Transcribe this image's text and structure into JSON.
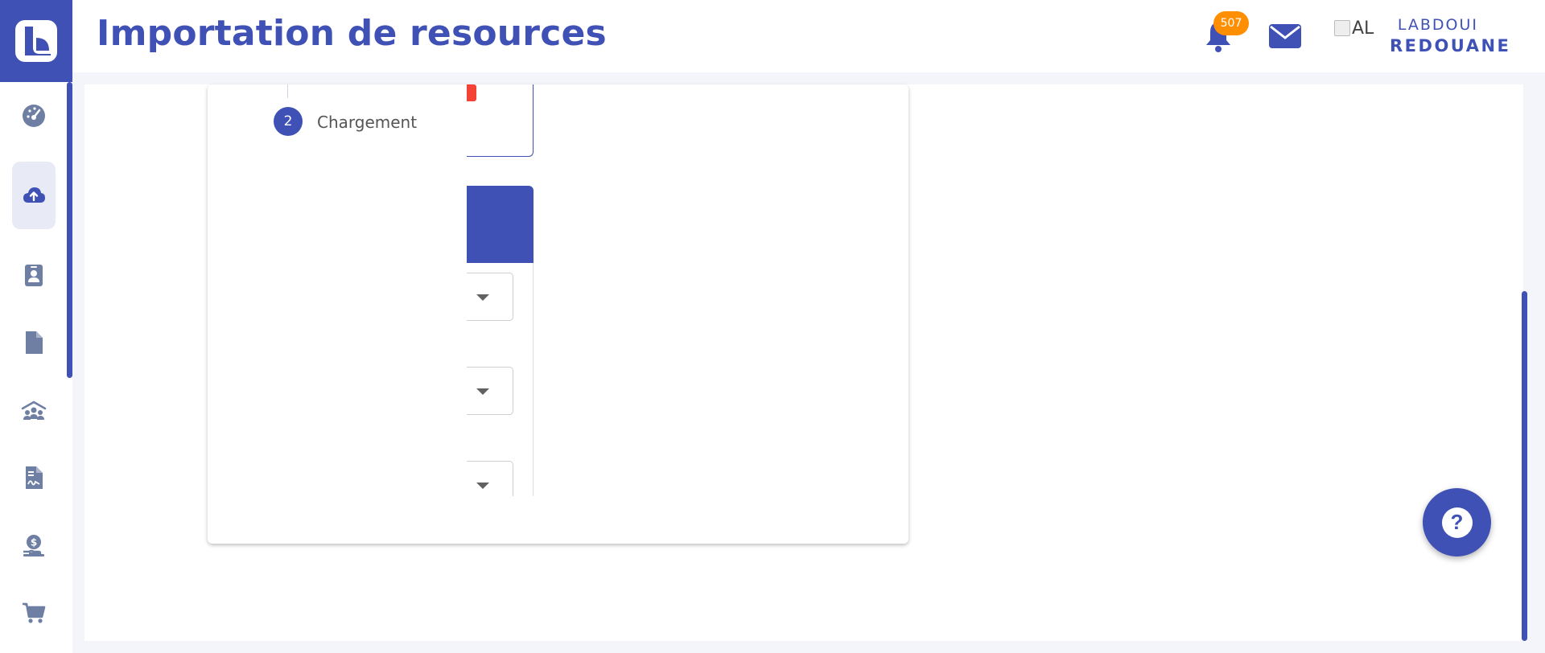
{
  "header": {
    "title": "Importation de resources",
    "notifications_count": "507",
    "avatar_alt": "AL",
    "user_first": "LABDOUI",
    "user_last": "REDOUANE"
  },
  "sidebar": {
    "items": [
      {
        "icon": "dashboard-gauge-icon"
      },
      {
        "icon": "cloud-upload-icon",
        "active": true
      },
      {
        "icon": "contact-card-icon"
      },
      {
        "icon": "document-icon"
      },
      {
        "icon": "team-icon"
      },
      {
        "icon": "signed-document-icon"
      },
      {
        "icon": "money-hand-icon"
      },
      {
        "icon": "shopping-cart-icon"
      }
    ]
  },
  "stepper": {
    "step_number": "2",
    "step_label": "Chargement"
  },
  "help": {
    "label": "?"
  },
  "colors": {
    "primary": "#3f51b5",
    "badge": "#ff8f00",
    "error": "#f44336",
    "background": "#f4f5fa"
  }
}
